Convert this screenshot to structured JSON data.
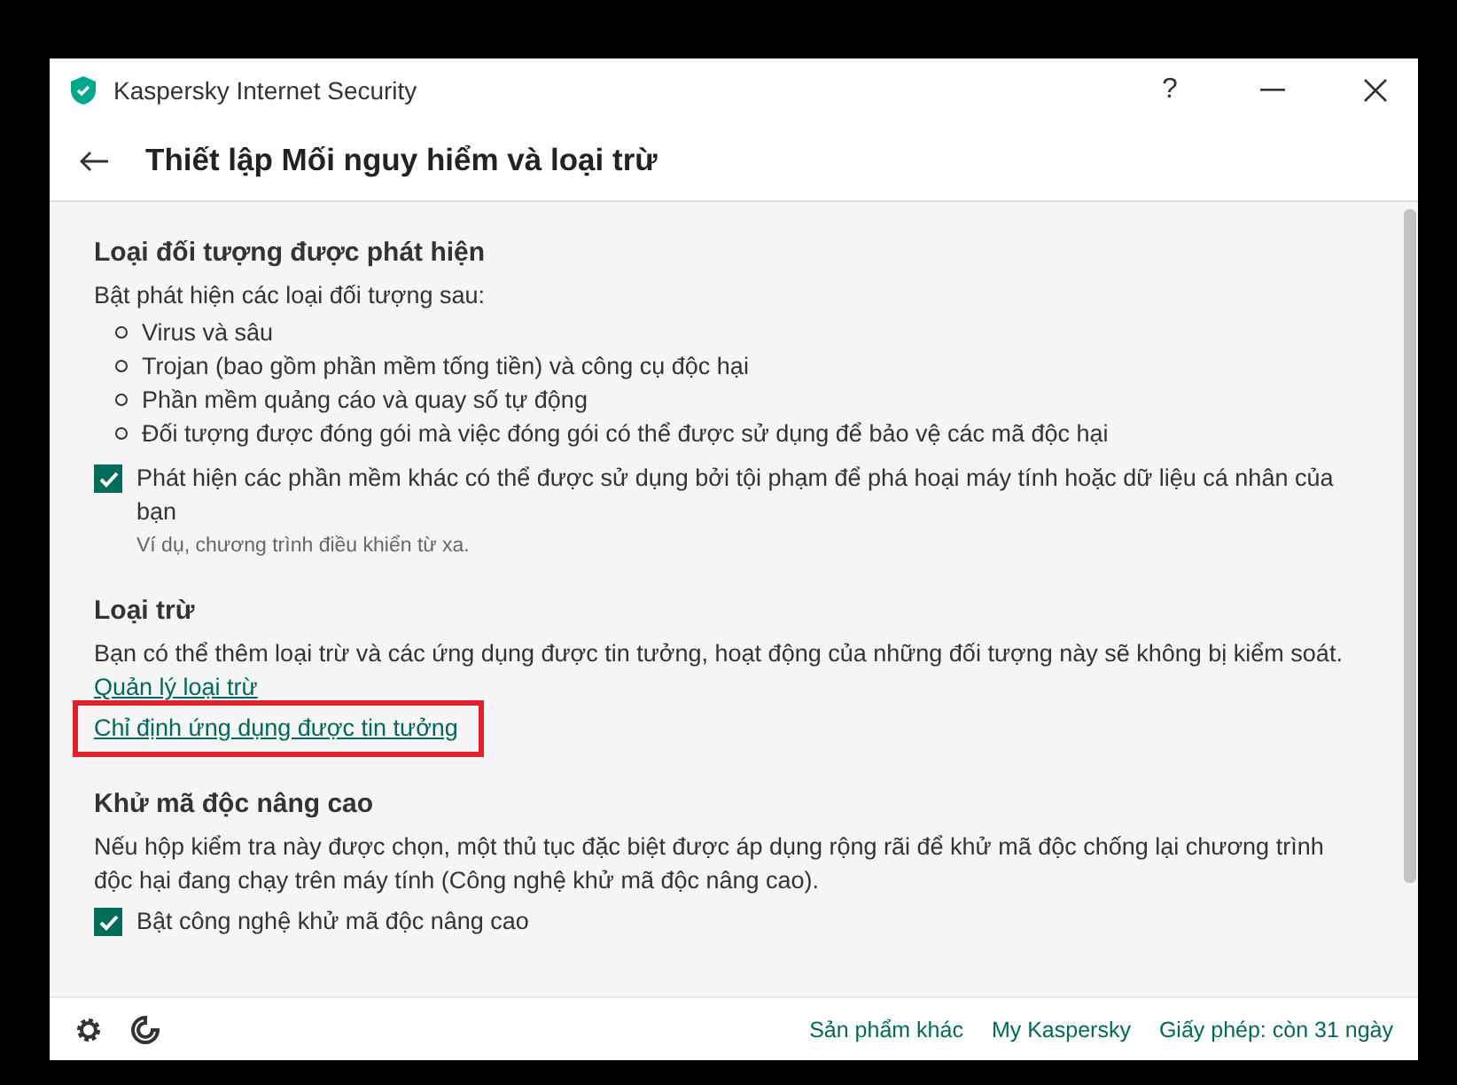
{
  "window": {
    "title": "Kaspersky Internet Security",
    "buttons": [
      "?"
    ]
  },
  "header": {
    "title": "Thiết lập Mối nguy hiểm và loại trừ"
  },
  "sections": [
    {
      "title": "Loại đối tượng được phát hiện",
      "text": "Bật phát hiện các loại đối tượng sau:",
      "bullets": [
        "Virus và sâu",
        "Trojan (bao gồm phần mềm tống tiền) và công cụ độc hại",
        "Phần mềm quảng cáo và quay số tự động",
        "Đối tượng được đóng gói mà việc đóng gói có thể được sử dụng để bảo vệ các mã độc hại"
      ],
      "checkboxes": [
        {
          "label": "Phát hiện các phần mềm khác có thể được sử dụng bởi tội phạm để phá hoại máy tính hoặc dữ liệu cá nhân của bạn",
          "checked": true,
          "hint": "Ví dụ, chương trình điều khiển từ xa."
        }
      ]
    },
    {
      "title": "Loại trừ",
      "text": "Bạn có thể thêm loại trừ và các ứng dụng được tin tưởng, hoạt động của những đối tượng này sẽ không bị kiểm soát.",
      "links": [
        {
          "label": "Quản lý loại trừ",
          "highlighted": false
        },
        {
          "label": "Chỉ định ứng dụng được tin tưởng",
          "highlighted": true
        }
      ]
    },
    {
      "title": "Khử mã độc nâng cao",
      "text": "Nếu hộp kiểm tra này được chọn, một thủ tục đặc biệt được áp dụng rộng rãi để khử mã độc chống lại chương trình độc hại đang chạy trên máy tính (Công nghệ khử mã độc nâng cao).",
      "checkboxes": [
        {
          "label": "Bật công nghệ khử mã độc nâng cao",
          "checked": true
        }
      ]
    }
  ],
  "footer": {
    "links": [
      "Sản phẩm khác",
      "My Kaspersky",
      "Giấy phép: còn 31 ngày"
    ]
  }
}
